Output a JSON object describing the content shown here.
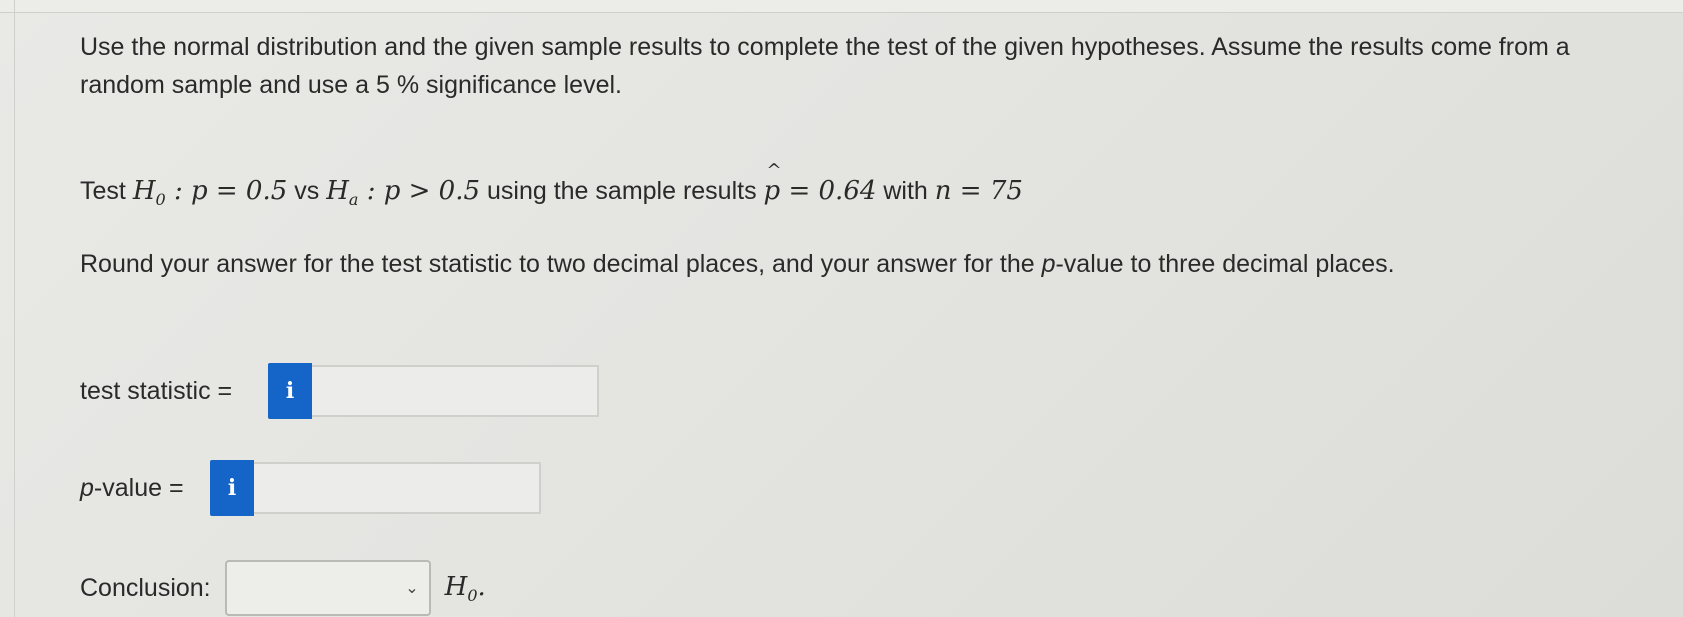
{
  "question": {
    "prompt": "Use the normal distribution and the given sample results to complete the test of the given hypotheses. Assume the results come from a random sample and use a 5 % significance level.",
    "test_prefix": "Test",
    "h0_symbol": "H",
    "h0_sub": "0",
    "h0_statement": " : p = 0.5",
    "vs_text": "vs",
    "ha_symbol": "H",
    "ha_sub": "a",
    "ha_statement": " : p > 0.5",
    "sample_text": "using the sample results",
    "phat_symbol": "p",
    "phat_value": " = 0.64",
    "with_text": "with",
    "n_symbol": "n",
    "n_value": " = 75",
    "rounding_instruction_1": "Round your answer for the test statistic to two decimal places, and your answer for the ",
    "rounding_p": "p",
    "rounding_instruction_2": "-value to three decimal places."
  },
  "fields": {
    "test_statistic_label": "test statistic =",
    "test_statistic_value": "",
    "p_value_label_p": "p",
    "p_value_label_rest": "-value =",
    "p_value_value": "",
    "info_icon": "i",
    "conclusion_label": "Conclusion:",
    "conclusion_selected": "",
    "conclusion_after_symbol": "H",
    "conclusion_after_sub": "0",
    "conclusion_after_period": "."
  },
  "icons": {
    "info": "info-icon",
    "dropdown": "chevron-down-icon"
  },
  "colors": {
    "info_button": "#1565c8",
    "background": "#e6e6e3",
    "text": "#2a2a2a"
  }
}
